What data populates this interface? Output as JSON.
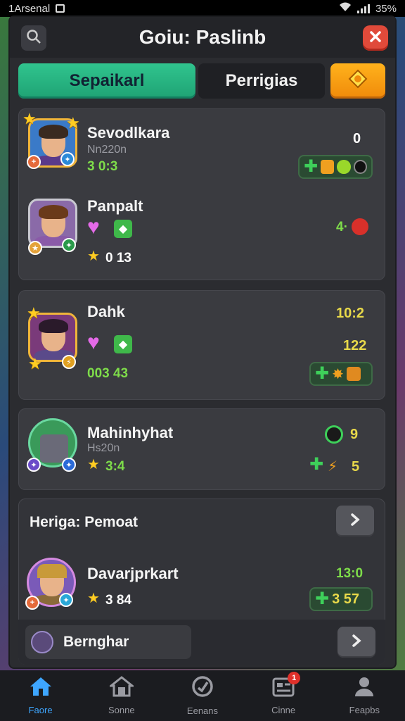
{
  "status_bar": {
    "carrier": "1Arsenal",
    "battery": "35%"
  },
  "header": {
    "title": "Goiu: Paslinb",
    "search_icon": "search-icon",
    "close_icon": "close-icon"
  },
  "tabs": [
    {
      "label": "Sepaikarl",
      "active": true
    },
    {
      "label": "Perrigias",
      "active": false
    },
    {
      "label": "",
      "icon": "gem-icon"
    }
  ],
  "players": [
    {
      "name": "Sevodlkara",
      "sub": "Nn220n",
      "score": "3 0:3",
      "right_value": "0"
    },
    {
      "name": "Panpalt",
      "score": "0 13",
      "right_value": "4·"
    },
    {
      "name": "Dahk",
      "score": "003 43",
      "right_value_top": "10:2",
      "right_value_mid": "122"
    },
    {
      "name": "Mahinhyhat",
      "sub": "Hs20n",
      "score": "3:4",
      "right_value_top": "9",
      "right_value_bottom": "5"
    }
  ],
  "section": {
    "title": "Heriga: Pemoat",
    "player": {
      "name": "Davarjprkart",
      "score": "3 84",
      "right_value": "13:0",
      "pill_text": "3 57"
    }
  },
  "footer_row": {
    "label": "Bernghar"
  },
  "bottom_nav": [
    {
      "label": "Faore",
      "icon": "home-icon",
      "active": true
    },
    {
      "label": "Sonne",
      "icon": "store-icon",
      "active": false
    },
    {
      "label": "Eenans",
      "icon": "target-icon",
      "active": false
    },
    {
      "label": "Cinne",
      "icon": "news-icon",
      "active": false,
      "badge": "1"
    },
    {
      "label": "Feapbs",
      "icon": "profile-icon",
      "active": false
    }
  ],
  "colors": {
    "accent_green": "#1fa374",
    "accent_gold": "#f08a0a",
    "active_nav": "#3ea6ff"
  }
}
